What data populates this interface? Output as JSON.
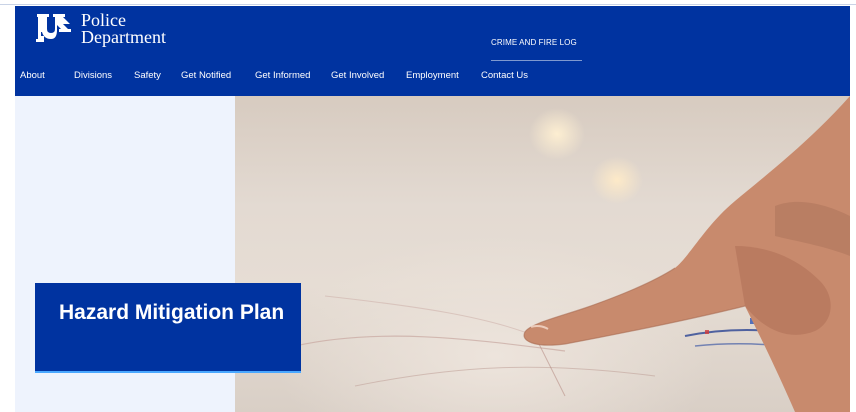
{
  "brand": {
    "logo_line1": "Police",
    "logo_line2": "Department",
    "colors": {
      "primary": "#0033a0",
      "accent": "#4aa8ff",
      "hero_bg": "#eef3fd"
    }
  },
  "utility": {
    "crime_fire_log": "CRIME AND FIRE LOG"
  },
  "nav": [
    {
      "label": "About"
    },
    {
      "label": "Divisions"
    },
    {
      "label": "Safety"
    },
    {
      "label": "Get Notified"
    },
    {
      "label": "Get Informed"
    },
    {
      "label": "Get Involved"
    },
    {
      "label": "Employment"
    },
    {
      "label": "Contact Us"
    }
  ],
  "hero": {
    "title": "Hazard Mitigation Plan",
    "image_icon": "map-pointing-photo"
  }
}
